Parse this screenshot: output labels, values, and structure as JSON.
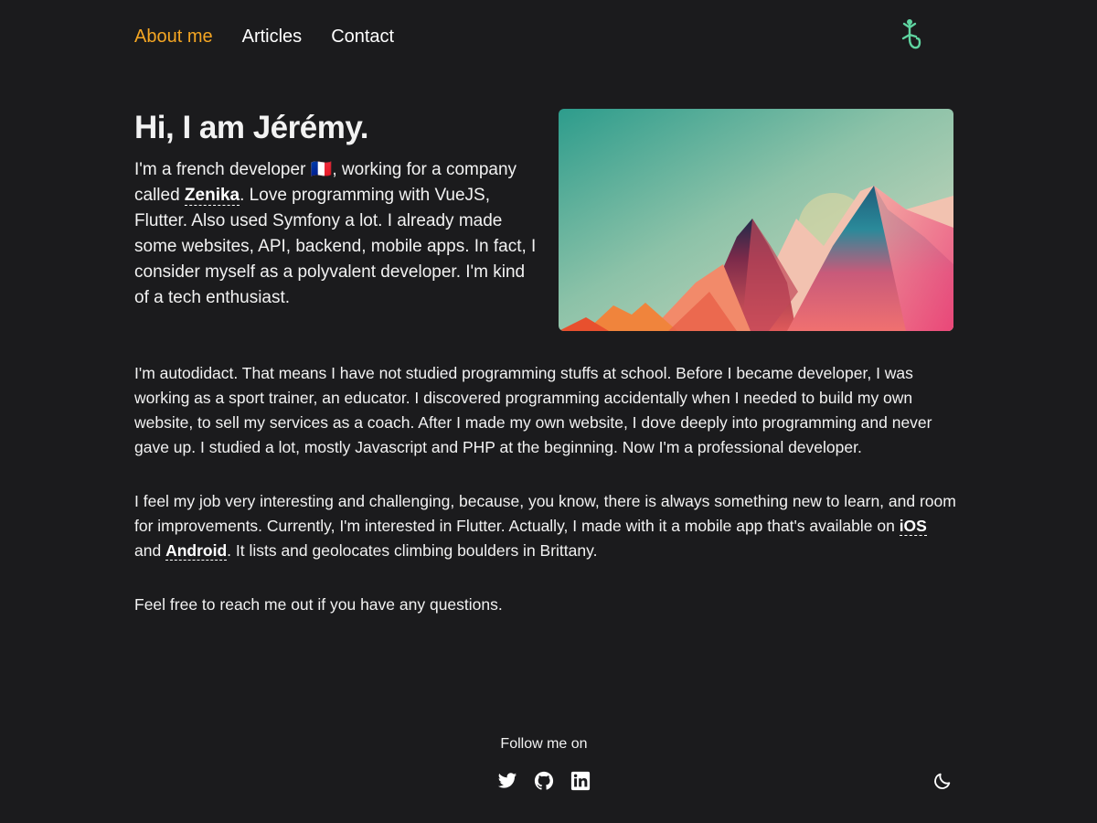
{
  "nav": {
    "about": "About me",
    "articles": "Articles",
    "contact": "Contact"
  },
  "hero": {
    "title": "Hi, I am Jérémy.",
    "text_1": "I'm a french developer ",
    "flag": "🇫🇷",
    "text_2": ", working for a company called ",
    "company_link": "Zenika",
    "text_3": ". Love programming with VueJS, Flutter. Also used Symfony a lot. I already made some websites, API, backend, mobile apps. In fact, I consider myself as a polyvalent developer. I'm kind of a tech enthusiast."
  },
  "body": {
    "paragraph_1": "I'm autodidact. That means I have not studied programming stuffs at school. Before I became developer, I was working as a sport trainer, an educator. I discovered programming accidentally when I needed to build my own website, to sell my services as a coach. After I made my own website, I dove deeply into programming and never gave up. I studied a lot, mostly Javascript and PHP at the beginning. Now I'm a professional developer.",
    "paragraph_2_a": "I feel my job very interesting and challenging, because, you know, there is always something new to learn, and room for improvements. Currently, I'm interested in Flutter. Actually, I made with it a mobile app that's available on ",
    "ios_link": "iOS",
    "paragraph_2_b": " and ",
    "android_link": "Android",
    "paragraph_2_c": ". It lists and geolocates climbing boulders in Brittany.",
    "paragraph_3": "Feel free to reach me out if you have any questions."
  },
  "footer": {
    "follow_label": "Follow me on",
    "social_icons": [
      "twitter-icon",
      "github-icon",
      "linkedin-icon"
    ],
    "theme_icon": "moon-icon"
  },
  "colors": {
    "background": "#1b1b1d",
    "text": "#f2f2f2",
    "accent": "#f5a623",
    "logo": "#5fd4a0"
  }
}
